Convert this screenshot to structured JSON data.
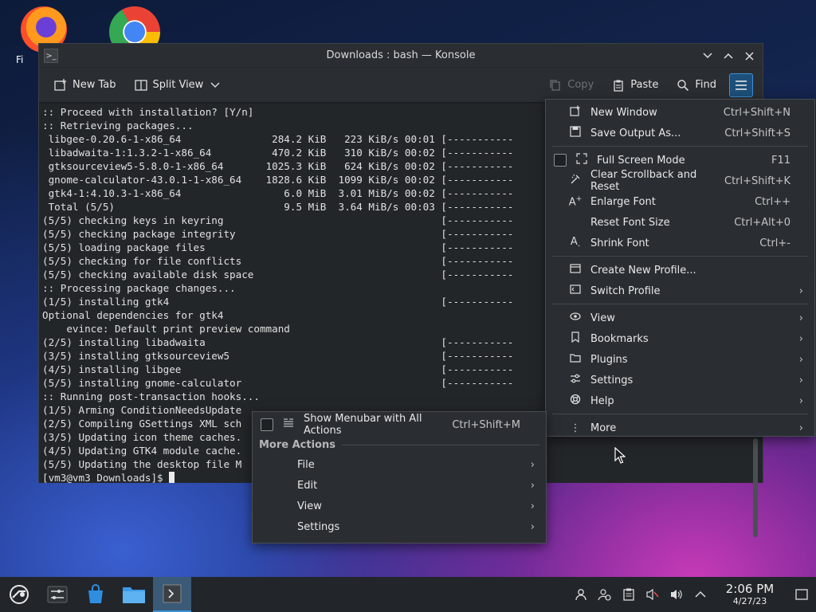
{
  "desktop": {
    "icons": [
      {
        "label": "Fi",
        "icon": "firefox-icon"
      },
      {
        "label": "",
        "icon": "chrome-icon"
      }
    ]
  },
  "window": {
    "title": "Downloads : bash — Konsole"
  },
  "toolbar": {
    "new_tab": "New Tab",
    "split_view": "Split View",
    "copy": "Copy",
    "paste": "Paste",
    "find": "Find"
  },
  "terminal": {
    "lines": [
      ":: Proceed with installation? [Y/n]",
      ":: Retrieving packages...",
      " libgee-0.20.6-1-x86_64               284.2 KiB   223 KiB/s 00:01 [-----------",
      " libadwaita-1:1.3.2-1-x86_64          470.2 KiB   310 KiB/s 00:02 [-----------",
      " gtksourceview5-5.8.0-1-x86_64       1025.3 KiB   624 KiB/s 00:02 [-----------",
      " gnome-calculator-43.0.1-1-x86_64    1828.6 KiB  1099 KiB/s 00:02 [-----------",
      " gtk4-1:4.10.3-1-x86_64                 6.0 MiB  3.01 MiB/s 00:02 [-----------",
      " Total (5/5)                            9.5 MiB  3.64 MiB/s 00:03 [-----------",
      "(5/5) checking keys in keyring                                    [-----------",
      "(5/5) checking package integrity                                  [-----------",
      "(5/5) loading package files                                       [-----------",
      "(5/5) checking for file conflicts                                 [-----------",
      "(5/5) checking available disk space                               [-----------",
      ":: Processing package changes...",
      "(1/5) installing gtk4                                             [-----------",
      "Optional dependencies for gtk4",
      "    evince: Default print preview command",
      "(2/5) installing libadwaita                                       [-----------",
      "(3/5) installing gtksourceview5                                   [-----------",
      "(4/5) installing libgee                                           [-----------",
      "(5/5) installing gnome-calculator                                 [-----------",
      ":: Running post-transaction hooks...",
      "(1/5) Arming ConditionNeedsUpdate",
      "(2/5) Compiling GSettings XML sch",
      "(3/5) Updating icon theme caches.",
      "(4/5) Updating GTK4 module cache.",
      "(5/5) Updating the desktop file M"
    ],
    "prompt": "[vm3@vm3 Downloads]$ "
  },
  "menu": {
    "items": [
      {
        "label": "New Window",
        "shortcut": "Ctrl+Shift+N",
        "icon": "new-window-icon"
      },
      {
        "label": "Save Output As...",
        "shortcut": "Ctrl+Shift+S",
        "icon": "save-icon"
      },
      {
        "label": "Full Screen Mode",
        "shortcut": "F11",
        "icon": "fullscreen-icon"
      },
      {
        "label": "Clear Scrollback and Reset",
        "shortcut": "Ctrl+Shift+K",
        "icon": "clear-icon"
      },
      {
        "label": "Enlarge Font",
        "shortcut": "Ctrl++",
        "icon": "enlarge-font-icon"
      },
      {
        "label": "Reset Font Size",
        "shortcut": "Ctrl+Alt+0",
        "icon": ""
      },
      {
        "label": "Shrink Font",
        "shortcut": "Ctrl+-",
        "icon": "shrink-font-icon"
      },
      {
        "label": "Create New Profile...",
        "shortcut": "",
        "icon": "new-profile-icon"
      },
      {
        "label": "Switch Profile",
        "shortcut": "",
        "icon": "switch-profile-icon"
      },
      {
        "label": "View",
        "shortcut": "",
        "icon": "view-icon"
      },
      {
        "label": "Bookmarks",
        "shortcut": "",
        "icon": "bookmarks-icon"
      },
      {
        "label": "Plugins",
        "shortcut": "",
        "icon": "plugins-icon"
      },
      {
        "label": "Settings",
        "shortcut": "",
        "icon": "settings-icon"
      },
      {
        "label": "Help",
        "shortcut": "",
        "icon": "help-icon"
      },
      {
        "label": "More",
        "shortcut": "",
        "icon": "more-icon"
      }
    ]
  },
  "submenu": {
    "show_menubar": {
      "label": "Show Menubar with All Actions",
      "shortcut": "Ctrl+Shift+M"
    },
    "heading": "More Actions",
    "items": [
      "File",
      "Edit",
      "View",
      "Settings"
    ]
  },
  "taskbar": {
    "time": "2:06 PM",
    "date": "4/27/23"
  },
  "colors": {
    "accent": "#3d8fd8",
    "menu_bg": "#2a2e32",
    "terminal_bg": "#232629"
  }
}
